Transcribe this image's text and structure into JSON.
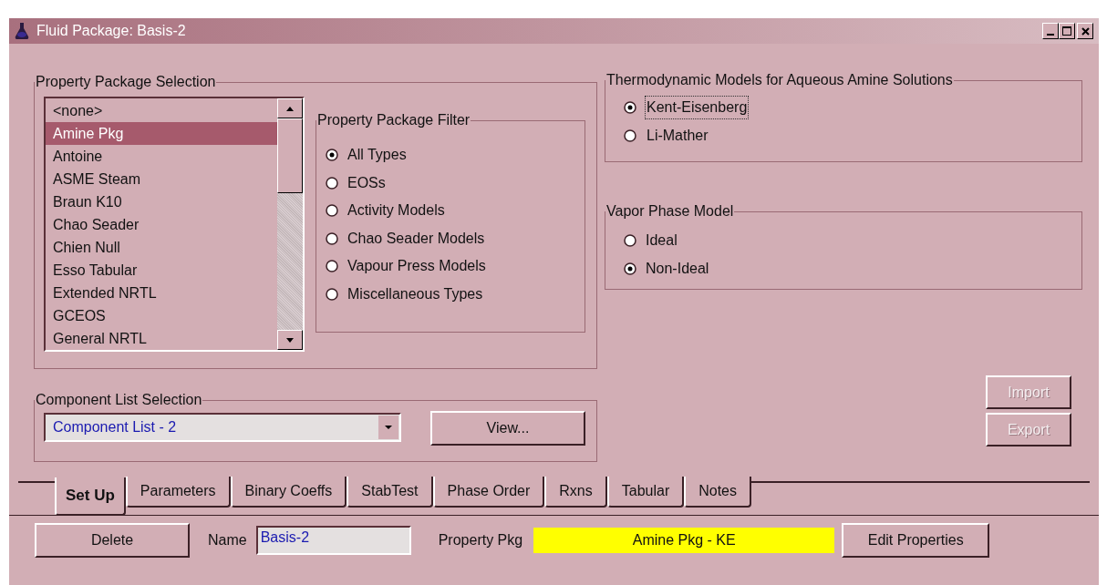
{
  "window": {
    "title": "Fluid Package: Basis-2"
  },
  "property_package_selection": {
    "label": "Property Package Selection",
    "list": [
      {
        "text": "<none>",
        "selected": false
      },
      {
        "text": "Amine Pkg",
        "selected": true
      },
      {
        "text": "Antoine",
        "selected": false
      },
      {
        "text": "ASME Steam",
        "selected": false
      },
      {
        "text": "Braun K10",
        "selected": false
      },
      {
        "text": "Chao Seader",
        "selected": false
      },
      {
        "text": "Chien Null",
        "selected": false
      },
      {
        "text": "Esso Tabular",
        "selected": false
      },
      {
        "text": "Extended NRTL",
        "selected": false
      },
      {
        "text": "GCEOS",
        "selected": false
      },
      {
        "text": "General NRTL",
        "selected": false
      }
    ],
    "filter": {
      "label": "Property Package Filter",
      "options": [
        {
          "label": "All Types",
          "selected": true
        },
        {
          "label": "EOSs",
          "selected": false
        },
        {
          "label": "Activity Models",
          "selected": false
        },
        {
          "label": "Chao Seader Models",
          "selected": false
        },
        {
          "label": "Vapour Press Models",
          "selected": false
        },
        {
          "label": "Miscellaneous Types",
          "selected": false
        }
      ]
    }
  },
  "thermodynamic_models": {
    "label": "Thermodynamic Models for Aqueous Amine Solutions",
    "options": [
      {
        "label": "Kent-Eisenberg",
        "selected": true,
        "focused": true
      },
      {
        "label": "Li-Mather",
        "selected": false,
        "focused": false
      }
    ]
  },
  "vapor_phase_model": {
    "label": "Vapor Phase Model",
    "options": [
      {
        "label": "Ideal",
        "selected": false
      },
      {
        "label": "Non-Ideal",
        "selected": true
      }
    ]
  },
  "component_list_selection": {
    "label": "Component List Selection",
    "value": "Component List - 2",
    "button": "View..."
  },
  "side_buttons": [
    {
      "label": "Import",
      "disabled": true
    },
    {
      "label": "Export",
      "disabled": true
    }
  ],
  "tabs": [
    {
      "label": "Set Up",
      "selected": true
    },
    {
      "label": "Parameters",
      "selected": false
    },
    {
      "label": "Binary Coeffs",
      "selected": false
    },
    {
      "label": "StabTest",
      "selected": false
    },
    {
      "label": "Phase Order",
      "selected": false
    },
    {
      "label": "Rxns",
      "selected": false
    },
    {
      "label": "Tabular",
      "selected": false
    },
    {
      "label": "Notes",
      "selected": false
    }
  ],
  "bottom_bar": {
    "delete_button": "Delete",
    "name_label": "Name",
    "name_value": "Basis-2",
    "property_pkg_label": "Property Pkg",
    "property_pkg_value": "Amine Pkg - KE",
    "edit_button": "Edit Properties"
  }
}
